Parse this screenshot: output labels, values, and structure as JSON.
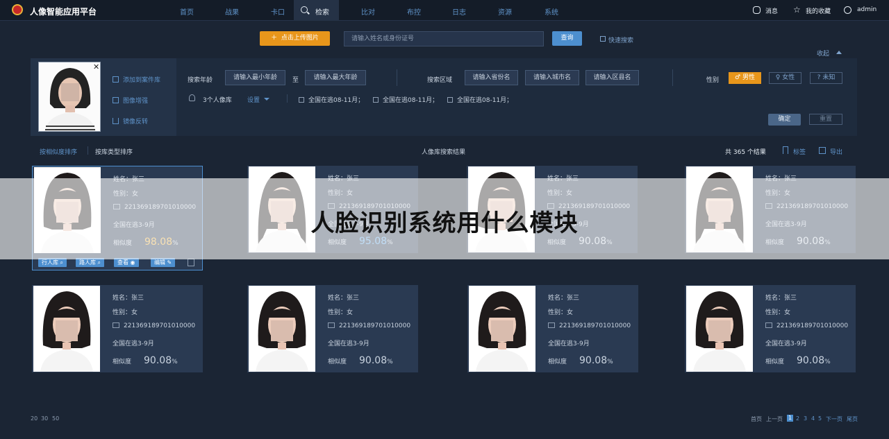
{
  "app": {
    "title": "人像智能应用平台"
  },
  "nav": {
    "items": [
      "首页",
      "战果",
      "卡口",
      "检索",
      "比对",
      "布控",
      "日志",
      "资源",
      "系统"
    ],
    "active": "检索"
  },
  "top_right": {
    "messages": "消息",
    "favorites": "我的收藏",
    "user": "admin"
  },
  "search": {
    "upload_label": "点击上传图片",
    "placeholder": "请输入姓名或身份证号",
    "query_label": "查询",
    "quick_label": "快速搜索",
    "collapse_label": "收起"
  },
  "photo_actions": {
    "add_case": "添加到案件库",
    "enhance": "图像增强",
    "mirror": "镜像反转"
  },
  "filters": {
    "age_label": "搜索年龄",
    "age_min_placeholder": "请输入最小年龄",
    "age_to": "至",
    "age_max_placeholder": "请输入最大年龄",
    "region_label": "搜索区域",
    "province_placeholder": "请输入省份名",
    "city_placeholder": "请输入城市名",
    "district_placeholder": "请输入区县名",
    "gender_label": "性别",
    "gender_male": "男性",
    "gender_female": "女性",
    "gender_unknown": "未知",
    "libraries_label": "3个人像库",
    "settings_label": "设置",
    "tags": [
      "全国在逃08-11月；",
      "全国在逃08-11月；",
      "全国在逃08-11月；"
    ],
    "confirm_label": "确定",
    "reset_label": "重置"
  },
  "results": {
    "sort_similarity": "按相似度排序",
    "sort_library": "按库类型排序",
    "title": "人像库搜索结果",
    "total": "共 365 个结果",
    "tag_label": "标签",
    "export_label": "导出"
  },
  "cards": [
    {
      "name": "姓名：张三",
      "gender": "性别：女",
      "id": "221369189701010000",
      "library": "全国在逃3-9月",
      "sim_label": "相似度",
      "similarity": "98.08",
      "unit": "%"
    },
    {
      "name": "姓名：张三",
      "gender": "性别：女",
      "id": "221369189701010000",
      "library": "全国在逃3-9月",
      "sim_label": "相似度",
      "similarity": "95.08",
      "unit": "%"
    },
    {
      "name": "姓名：张三",
      "gender": "性别：女",
      "id": "221369189701010000",
      "library": "全国在逃3-9月",
      "sim_label": "相似度",
      "similarity": "90.08",
      "unit": "%"
    },
    {
      "name": "姓名：张三",
      "gender": "性别：女",
      "id": "221369189701010000",
      "library": "全国在逃3-9月",
      "sim_label": "相似度",
      "similarity": "90.08",
      "unit": "%"
    },
    {
      "name": "姓名：张三",
      "gender": "性别：女",
      "id": "221369189701010000",
      "library": "全国在逃3-9月",
      "sim_label": "相似度",
      "similarity": "90.08",
      "unit": "%"
    },
    {
      "name": "姓名：张三",
      "gender": "性别：女",
      "id": "221369189701010000",
      "library": "全国在逃3-9月",
      "sim_label": "相似度",
      "similarity": "90.08",
      "unit": "%"
    },
    {
      "name": "姓名：张三",
      "gender": "性别：女",
      "id": "221369189701010000",
      "library": "全国在逃3-9月",
      "sim_label": "相似度",
      "similarity": "90.08",
      "unit": "%"
    },
    {
      "name": "姓名：张三",
      "gender": "性别：女",
      "id": "221369189701010000",
      "library": "全国在逃3-9月",
      "sim_label": "相似度",
      "similarity": "90.08",
      "unit": "%"
    }
  ],
  "card_actions": {
    "in_library": "行人库",
    "road_library": "路人库",
    "view": "查看",
    "edit": "编辑"
  },
  "overlay": {
    "text": "人脸识别系统用什么模块"
  },
  "pagination": {
    "page_sizes": [
      "20",
      "30",
      "50"
    ],
    "first": "首页",
    "prev": "上一页",
    "pages": [
      "1",
      "2",
      "3",
      "4",
      "5"
    ],
    "current": "1",
    "next": "下一页",
    "last": "尾页"
  },
  "colors": {
    "accent": "#4d8fcf",
    "warning": "#e8961b",
    "bg": "#1b2534",
    "gold": "#f0b23a"
  }
}
